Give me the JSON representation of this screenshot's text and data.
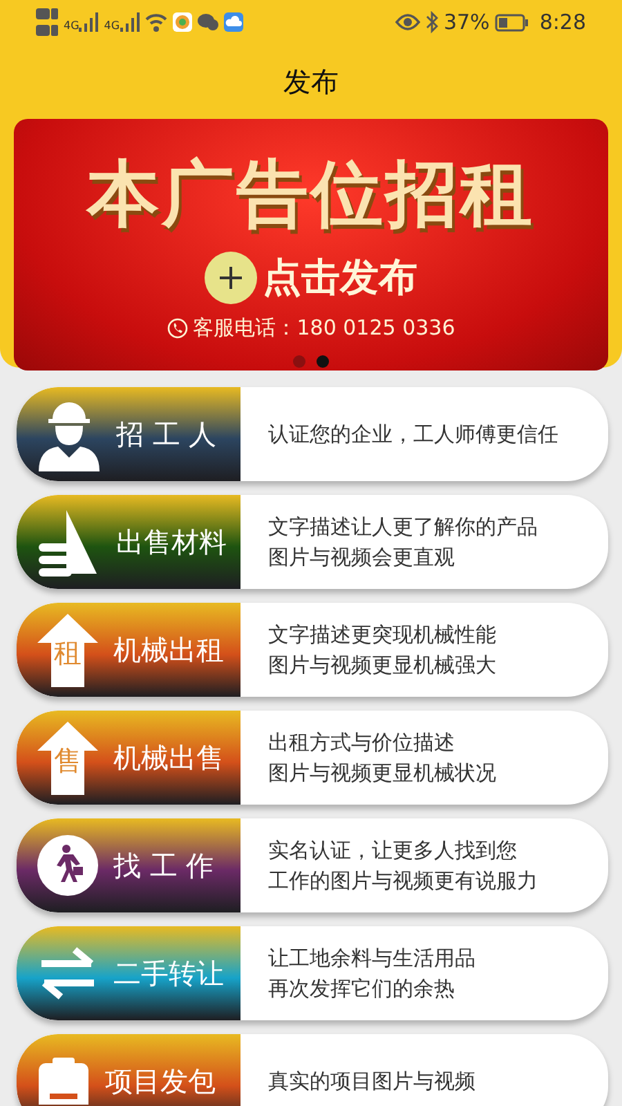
{
  "status_bar": {
    "signal_labels": [
      "4G",
      "4G"
    ],
    "battery": "37%",
    "time": "8:28"
  },
  "title": "发布",
  "banner": {
    "headline": "本广告位招租",
    "action": "点击发布",
    "hotline": "客服电话：180 0125 0336",
    "dots": [
      {
        "selected": false
      },
      {
        "selected": true
      }
    ]
  },
  "entries": [
    {
      "kind": "worker",
      "title": "招 工 人",
      "color": "#2c4560",
      "lines": [
        "认证您的企业，工人师傅更信任"
      ]
    },
    {
      "kind": "materials",
      "title": "出售材料",
      "color": "#1e5410",
      "lines": [
        "文字描述让人更了解你的产品",
        "图片与视频会更直观"
      ]
    },
    {
      "kind": "arrow",
      "icon_text": "租",
      "title": "机械出租",
      "color": "#d4501a",
      "lines": [
        "文字描述更突现机械性能",
        "图片与视频更显机械强大"
      ]
    },
    {
      "kind": "arrow",
      "icon_text": "售",
      "title": "机械出售",
      "color": "#d4501a",
      "lines": [
        "出租方式与价位描述",
        "图片与视频更显机械状况"
      ]
    },
    {
      "kind": "walker",
      "title": "找 工 作",
      "color": "#6b2a66",
      "lines": [
        "实名认证，让更多人找到您",
        "工作的图片与视频更有说服力"
      ]
    },
    {
      "kind": "swap",
      "title": "二手转让",
      "color": "#17a3c9",
      "lines": [
        "让工地余料与生活用品",
        "再次发挥它们的余热"
      ]
    },
    {
      "kind": "clipboard",
      "title": "项目发包",
      "color": "#d4501a",
      "lines": [
        "真实的项目图片与视频"
      ]
    }
  ]
}
